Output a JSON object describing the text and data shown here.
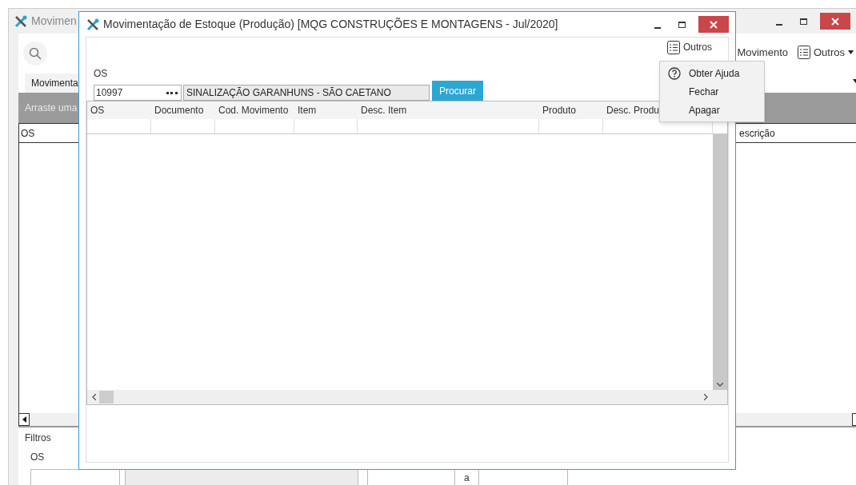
{
  "background_window": {
    "title": "Movimen",
    "tab": "Movimenta",
    "toolbar": [
      {
        "label": "Movimento",
        "icon": false,
        "caret": false
      },
      {
        "label": "Outros",
        "icon": true,
        "caret": true
      }
    ],
    "group_panel_hint": "Arraste uma",
    "columns": [
      {
        "label": "OS"
      },
      {
        "label": "escrição"
      }
    ],
    "filters": {
      "title": "Filtros",
      "os_label": "OS",
      "range_separator": "a"
    }
  },
  "window": {
    "title": "Movimentação de Estoque (Produção) [MQG CONSTRUÇÕES E MONTAGENS - Jul/2020]",
    "toolbar_button": "Outros",
    "os_field": {
      "label": "OS",
      "value": "10997",
      "description": "SINALIZAÇÃO GARANHUNS - SÃO CAETANO"
    },
    "search_button": "Procurar",
    "table": {
      "columns": [
        {
          "label": "OS"
        },
        {
          "label": "Documento"
        },
        {
          "label": "Cod. Movimento"
        },
        {
          "label": "Item"
        },
        {
          "label": "Desc. Item"
        },
        {
          "label": "Produto"
        },
        {
          "label": "Desc. Produ"
        }
      ]
    }
  },
  "menu": {
    "items": [
      {
        "label": "Obter Ajuda",
        "icon": true
      },
      {
        "label": "Fechar",
        "icon": false
      },
      {
        "label": "Apagar",
        "icon": false
      }
    ]
  }
}
